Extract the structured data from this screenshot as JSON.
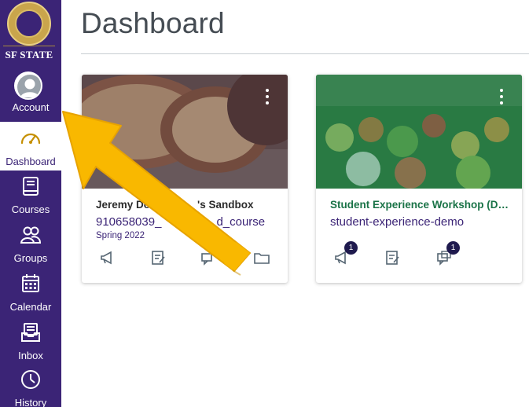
{
  "app": {
    "title": "Dashboard"
  },
  "nav": {
    "logo_text": "SF STATE",
    "seal_alt": "San Francisco State University seal",
    "items": [
      {
        "label": "Account",
        "icon": "user-avatar-icon",
        "active": false
      },
      {
        "label": "Dashboard",
        "icon": "speedometer-icon",
        "active": true
      },
      {
        "label": "Courses",
        "icon": "book-icon",
        "active": false
      },
      {
        "label": "Groups",
        "icon": "people-icon",
        "active": false
      },
      {
        "label": "Calendar",
        "icon": "calendar-icon",
        "active": false
      },
      {
        "label": "Inbox",
        "icon": "inbox-icon",
        "active": false
      },
      {
        "label": "History",
        "icon": "clock-icon",
        "active": false
      }
    ]
  },
  "cards": [
    {
      "title": "Jeremy D... Sandbox",
      "title_full": "Jeremy Do",
      "title_suffix": "'s Sandbox",
      "code": "910658039_",
      "code_suffix": "d_course",
      "term": "Spring 2022",
      "title_color": "#2b2b2b",
      "code_color": "#3b2476",
      "actions": [
        {
          "icon": "announcement-icon",
          "badge": null
        },
        {
          "icon": "assignment-icon",
          "badge": null
        },
        {
          "icon": "discussion-icon",
          "badge": null
        },
        {
          "icon": "folder-icon",
          "badge": null
        }
      ]
    },
    {
      "title": "Student Experience Workshop (De...",
      "code": "student-experience-demo",
      "term": "",
      "title_color": "#1a7347",
      "code_color": "#3b2476",
      "actions": [
        {
          "icon": "announcement-icon",
          "badge": "1"
        },
        {
          "icon": "assignment-icon",
          "badge": null
        },
        {
          "icon": "discussion-icon",
          "badge": "1"
        }
      ]
    }
  ],
  "colors": {
    "nav_bg": "#3b2476",
    "accent_gold": "#f9b800",
    "card_hero_1": "#6b4a3e",
    "card_hero_2": "#2e8a55"
  }
}
